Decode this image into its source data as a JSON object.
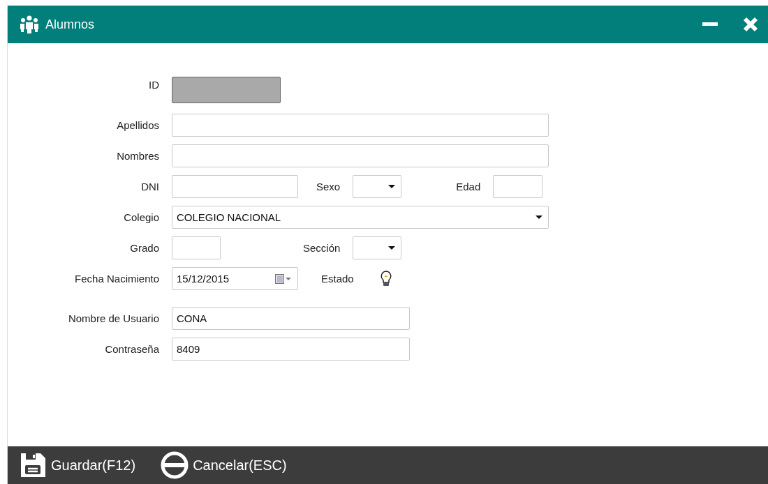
{
  "window": {
    "title": "Alumnos"
  },
  "rows": [
    [
      {
        "label": "ID",
        "kind": "text",
        "disabled": true
      }
    ],
    [
      {
        "label": "Apellidos",
        "kind": "text",
        "disabled": false
      }
    ],
    [
      {
        "label": "Nombres",
        "kind": "text",
        "disabled": false
      }
    ],
    [
      {
        "label": "DNI",
        "kind": "text",
        "disabled": false
      },
      {
        "label": "Sexo",
        "kind": "combo",
        "disabled": false
      },
      {
        "label": "Edad",
        "kind": "text",
        "disabled": false
      }
    ],
    [
      {
        "label": "Colegio",
        "kind": "combo",
        "value": "COLEGIO NACIONAL",
        "disabled": false
      }
    ],
    [
      {
        "label": "Grado",
        "kind": "text",
        "disabled": false
      },
      {
        "label": "Sección",
        "kind": "combo",
        "disabled": false
      }
    ],
    [
      {
        "label": "Fecha Nacimiento",
        "kind": "date",
        "value": "15/12/2015",
        "disabled": false
      },
      {
        "label": "Estado",
        "kind": "bulb"
      }
    ],
    [
      {
        "label": "Nombre de Usuario",
        "kind": "text",
        "value": "CONA",
        "disabled": false
      }
    ],
    [
      {
        "label": "Contraseña",
        "kind": "text",
        "value": "8409",
        "disabled": false
      }
    ]
  ],
  "buttons": [
    {
      "label": "Guardar(F12)",
      "kind": "save"
    },
    {
      "label": "Cancelar(ESC)",
      "kind": "cancel"
    }
  ]
}
